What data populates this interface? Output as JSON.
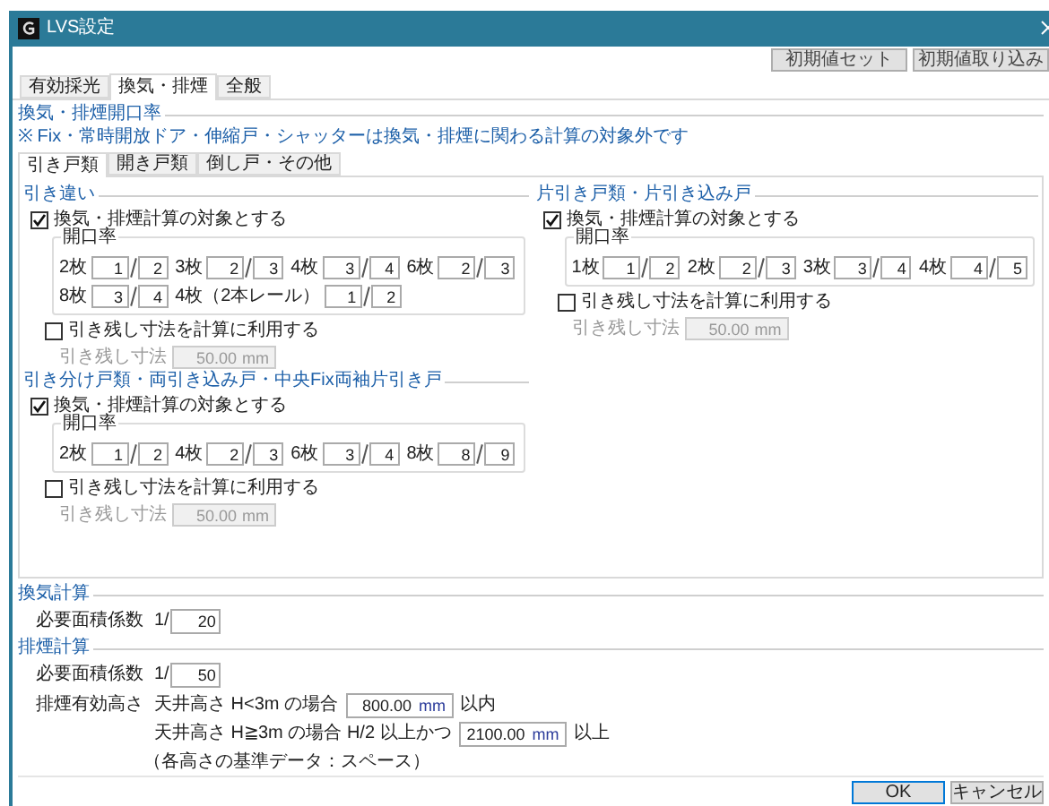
{
  "window": {
    "title": "LVS設定"
  },
  "toolbar_buttons": [
    "初期値セット",
    "初期値取り込み"
  ],
  "tabs": [
    {
      "label": "有効採光",
      "selected": false
    },
    {
      "label": "換気・排煙",
      "selected": true
    },
    {
      "label": "全般",
      "selected": false
    }
  ],
  "opening_ratio": {
    "title": "換気・排煙開口率",
    "note": "※ Fix・常時開放ドア・伸縮戸・シャッターは換気・排煙に関わる計算の対象外です"
  },
  "subtabs": [
    {
      "label": "引き戸類",
      "selected": true
    },
    {
      "label": "開き戸類",
      "selected": false
    },
    {
      "label": "倒し戸・その他",
      "selected": false
    }
  ],
  "left_column": [
    {
      "title": "引き違い",
      "include": {
        "label": "換気・排煙計算の対象とする",
        "checked": true
      },
      "ratio_title": "開口率",
      "ratio_rows": [
        [
          {
            "label": "2枚",
            "numerator": "1",
            "denominator": "2"
          },
          {
            "label": "3枚",
            "numerator": "2",
            "denominator": "3"
          },
          {
            "label": "4枚",
            "numerator": "3",
            "denominator": "4"
          },
          {
            "label": "6枚",
            "numerator": "2",
            "denominator": "3"
          }
        ],
        [
          {
            "label": "8枚",
            "numerator": "3",
            "denominator": "4"
          },
          {
            "label": "4枚（2本レール）",
            "numerator": "1",
            "denominator": "2"
          }
        ]
      ],
      "use_remaining": {
        "label": "引き残し寸法を計算に利用する",
        "checked": false
      },
      "remaining": {
        "label": "引き残し寸法",
        "value": "50.00",
        "unit": "mm",
        "disabled": true
      }
    },
    {
      "title": "引き分け戸類・両引き込み戸・中央Fix両袖片引き戸",
      "include": {
        "label": "換気・排煙計算の対象とする",
        "checked": true
      },
      "ratio_title": "開口率",
      "ratio_rows": [
        [
          {
            "label": "2枚",
            "numerator": "1",
            "denominator": "2"
          },
          {
            "label": "4枚",
            "numerator": "2",
            "denominator": "3"
          },
          {
            "label": "6枚",
            "numerator": "3",
            "denominator": "4"
          },
          {
            "label": "8枚",
            "numerator": "8",
            "denominator": "9"
          }
        ]
      ],
      "use_remaining": {
        "label": "引き残し寸法を計算に利用する",
        "checked": false
      },
      "remaining": {
        "label": "引き残し寸法",
        "value": "50.00",
        "unit": "mm",
        "disabled": true
      }
    }
  ],
  "right_column": [
    {
      "title": "片引き戸類・片引き込み戸",
      "include": {
        "label": "換気・排煙計算の対象とする",
        "checked": true
      },
      "ratio_title": "開口率",
      "ratio_rows": [
        [
          {
            "label": "1枚",
            "numerator": "1",
            "denominator": "2"
          },
          {
            "label": "2枚",
            "numerator": "2",
            "denominator": "3"
          },
          {
            "label": "3枚",
            "numerator": "3",
            "denominator": "4"
          },
          {
            "label": "4枚",
            "numerator": "4",
            "denominator": "5"
          }
        ]
      ],
      "use_remaining": {
        "label": "引き残し寸法を計算に利用する",
        "checked": false
      },
      "remaining": {
        "label": "引き残し寸法",
        "value": "50.00",
        "unit": "mm",
        "disabled": true
      }
    }
  ],
  "ventilation": {
    "title": "換気計算",
    "coef_label": "必要面積係数",
    "prefix": "1/",
    "value": "20"
  },
  "smoke": {
    "title": "排煙計算",
    "coef_label": "必要面積係数",
    "prefix": "1/",
    "value": "50",
    "height_label": "排煙有効高さ",
    "conditions": [
      {
        "condition": "天井高さ H<3m の場合",
        "value": "800.00",
        "unit": "mm",
        "suffix": "以内"
      },
      {
        "condition": "天井高さ H≧3m の場合 H/2 以上かつ",
        "value": "2100.00",
        "unit": "mm",
        "suffix": "以上"
      }
    ],
    "note": "（各高さの基準データ：スペース）"
  },
  "footer_buttons": [
    {
      "label": "OK",
      "default": true
    },
    {
      "label": "キャンセル",
      "default": false
    }
  ]
}
